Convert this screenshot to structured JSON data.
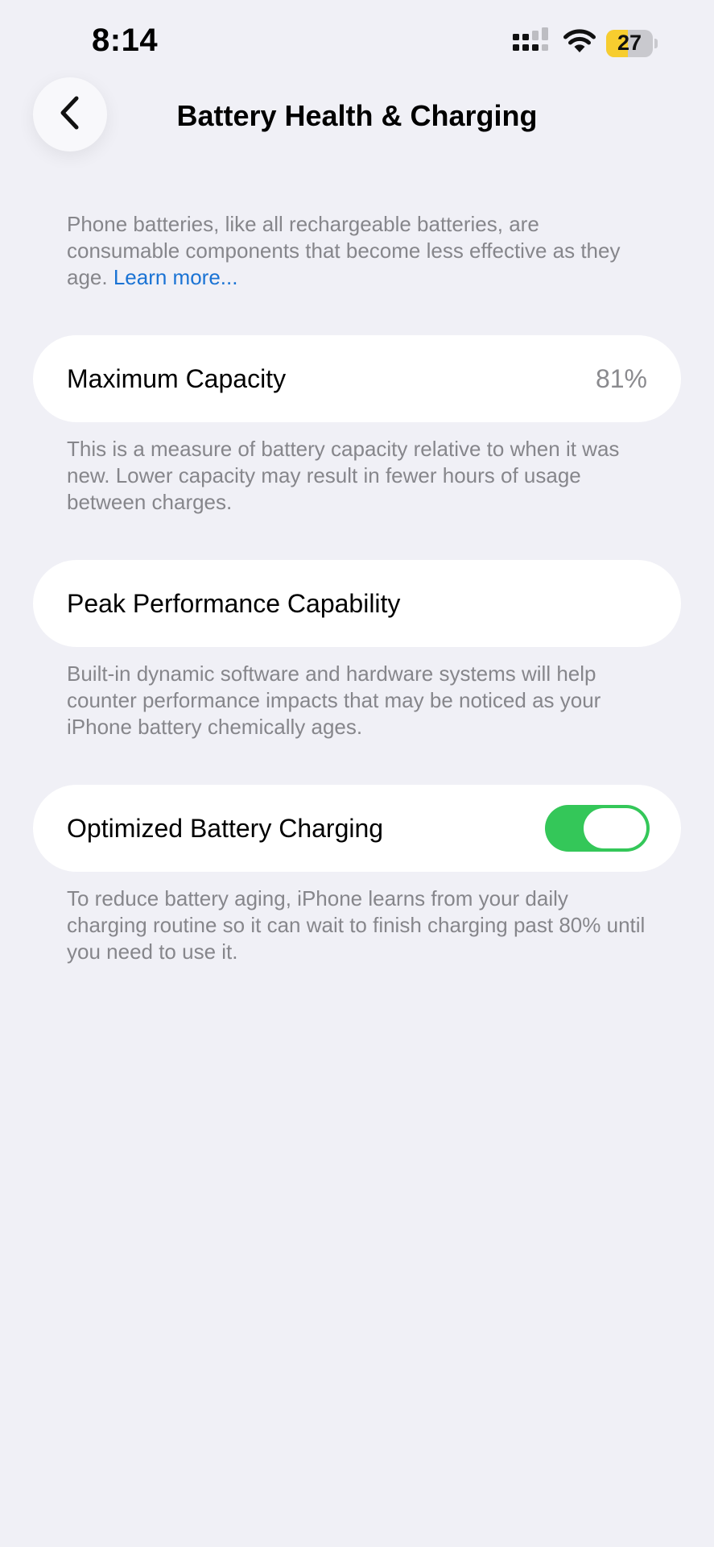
{
  "status_bar": {
    "time": "8:14",
    "battery_level": "27",
    "battery_fraction": 0.27,
    "icons": [
      "signal-icon",
      "wifi-icon",
      "battery-icon"
    ]
  },
  "nav": {
    "back_icon": "chevron-left-icon",
    "title": "Battery Health & Charging"
  },
  "intro": {
    "text": "Phone batteries, like all rechargeable batteries, are consumable components that become less effective as they age. ",
    "link_label": "Learn more..."
  },
  "max_capacity": {
    "label": "Maximum Capacity",
    "value": "81%",
    "footnote": "This is a measure of battery capacity relative to when it was new. Lower capacity may result in fewer hours of usage between charges."
  },
  "peak_performance": {
    "label": "Peak Performance Capability",
    "footnote": "Built-in dynamic software and hardware systems will help counter performance impacts that may be noticed as your iPhone battery chemically ages."
  },
  "optimized_charging": {
    "label": "Optimized Battery Charging",
    "enabled": true,
    "footnote": "To reduce battery aging, iPhone learns from your daily charging routine so it can wait to finish charging past 80% until you need to use it."
  },
  "colors": {
    "background": "#f0f0f6",
    "card": "#ffffff",
    "toggle_on": "#34c759",
    "link": "#1a73d4",
    "secondary_text": "#86868b",
    "battery_fill": "#f7cd2f"
  }
}
